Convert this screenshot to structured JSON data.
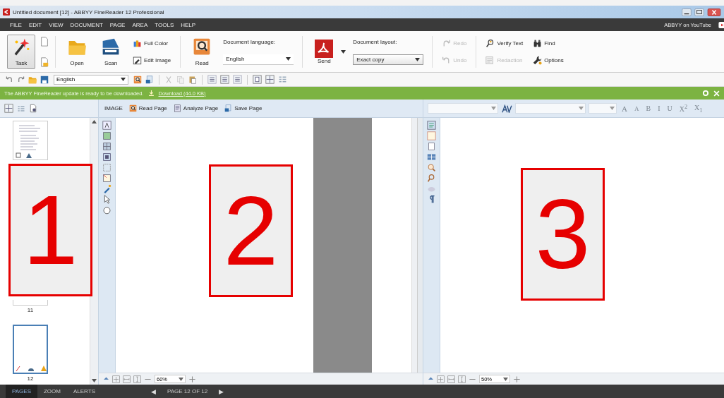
{
  "window": {
    "title": "Untitled document [12] - ABBYY FineReader 12 Professional"
  },
  "menu": {
    "items": [
      "FILE",
      "EDIT",
      "VIEW",
      "DOCUMENT",
      "PAGE",
      "AREA",
      "TOOLS",
      "HELP"
    ],
    "youtube_link": "ABBYY on YouTube"
  },
  "ribbon": [
    {
      "kind": "large",
      "label": "Task",
      "pressed": true
    },
    {
      "kind": "icons"
    },
    {
      "kind": "separator"
    },
    {
      "kind": "large",
      "label": "Open",
      "pressed": false
    },
    {
      "kind": "large",
      "label": "Scan",
      "pressed": false
    },
    {
      "kind": "stack",
      "items": [
        {
          "label": "Full Color",
          "disabled": false
        },
        {
          "label": "Edit Image",
          "disabled": false
        }
      ]
    },
    {
      "kind": "separator"
    },
    {
      "kind": "large",
      "label": "Read",
      "pressed": false
    },
    {
      "kind": "combo",
      "label": "Document language:",
      "value": "English"
    },
    {
      "kind": "separator"
    },
    {
      "kind": "split",
      "label": "Send",
      "pressed": false
    },
    {
      "kind": "combo",
      "label": "Document layout:",
      "value": "Exact copy"
    },
    {
      "kind": "separator"
    },
    {
      "kind": "stack",
      "items": [
        {
          "label": "Redo",
          "disabled": true
        },
        {
          "label": "Undo",
          "disabled": true
        }
      ]
    },
    {
      "kind": "separator"
    },
    {
      "kind": "stack",
      "items": [
        {
          "label": "Verify Text",
          "disabled": false
        },
        {
          "label": "Redaction",
          "disabled": true
        }
      ]
    },
    {
      "kind": "stack",
      "items": [
        {
          "label": "Find",
          "disabled": false
        },
        {
          "label": "Options",
          "disabled": false
        }
      ]
    }
  ],
  "quick_toolbar": {
    "language": "English"
  },
  "notification": {
    "message": "The ABBYY FineReader update is ready to be downloaded.",
    "link": "Download (44.0 KB)"
  },
  "pages_pane": {
    "thumbnails": [
      {
        "kind": "text-page",
        "selected": false
      },
      {
        "kind": "blank-page",
        "label": "11",
        "selected": false
      },
      {
        "kind": "blank-page",
        "label": "12",
        "selected": true
      }
    ]
  },
  "image_pane": {
    "mode": "IMAGE",
    "actions": [
      "Read Page",
      "Analyze Page",
      "Save Page"
    ],
    "zoom": "60%"
  },
  "text_pane": {
    "format_buttons": [
      {
        "text": "A",
        "disabled": true
      },
      {
        "text": "A",
        "disabled": true
      },
      {
        "text": "B",
        "disabled": true
      },
      {
        "text": "I",
        "disabled": true
      },
      {
        "text": "U",
        "disabled": true
      },
      {
        "text": "X$^{2}$",
        "disabled": true
      },
      {
        "text": "X$_{1}$",
        "disabled": true
      }
    ],
    "zoom": "50%"
  },
  "status_bar": {
    "tabs": [
      {
        "label": "PAGES",
        "selected": true
      },
      {
        "label": "ZOOM",
        "selected": false
      },
      {
        "label": "ALERTS",
        "selected": false
      }
    ],
    "prev": "◀",
    "page": "PAGE 12 OF 12",
    "next": "▶"
  },
  "annotations": [
    {
      "label": "1"
    },
    {
      "label": "2"
    },
    {
      "label": "3"
    }
  ]
}
